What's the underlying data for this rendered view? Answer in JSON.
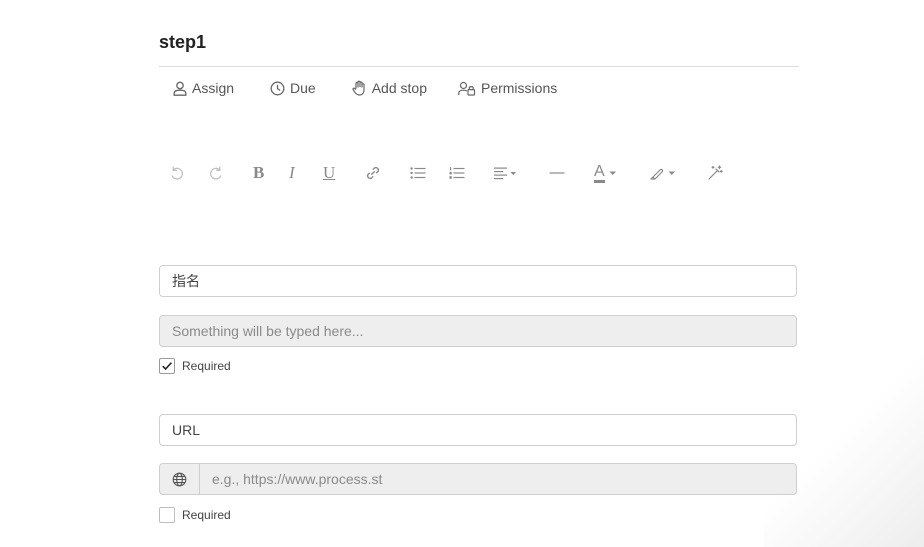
{
  "step": {
    "title": "step1"
  },
  "actions": {
    "assign": "Assign",
    "due": "Due",
    "add_stop": "Add stop",
    "permissions": "Permissions"
  },
  "toolbar": {
    "undo": "undo-icon",
    "redo": "redo-icon",
    "bold": "B",
    "italic": "I",
    "underline": "U",
    "link": "link-icon",
    "bullet_list": "bullet-list-icon",
    "numbered_list": "numbered-list-icon",
    "align": "align-left-icon",
    "horizontal_rule": "horizontal-rule-icon",
    "font_color": "A",
    "highlight": "highlighter-icon",
    "clear_format": "magic-wand-icon"
  },
  "form_fields": [
    {
      "label_value": "指名",
      "input_placeholder": "Something will be typed here...",
      "required_label": "Required",
      "required_checked": true
    },
    {
      "label_value": "URL",
      "input_placeholder": "e.g., https://www.process.st",
      "required_label": "Required",
      "required_checked": false
    }
  ],
  "colors": {
    "border": "#cfcfcf",
    "disabled_field_bg": "#eeeeee",
    "icon": "#8a8a8a"
  }
}
